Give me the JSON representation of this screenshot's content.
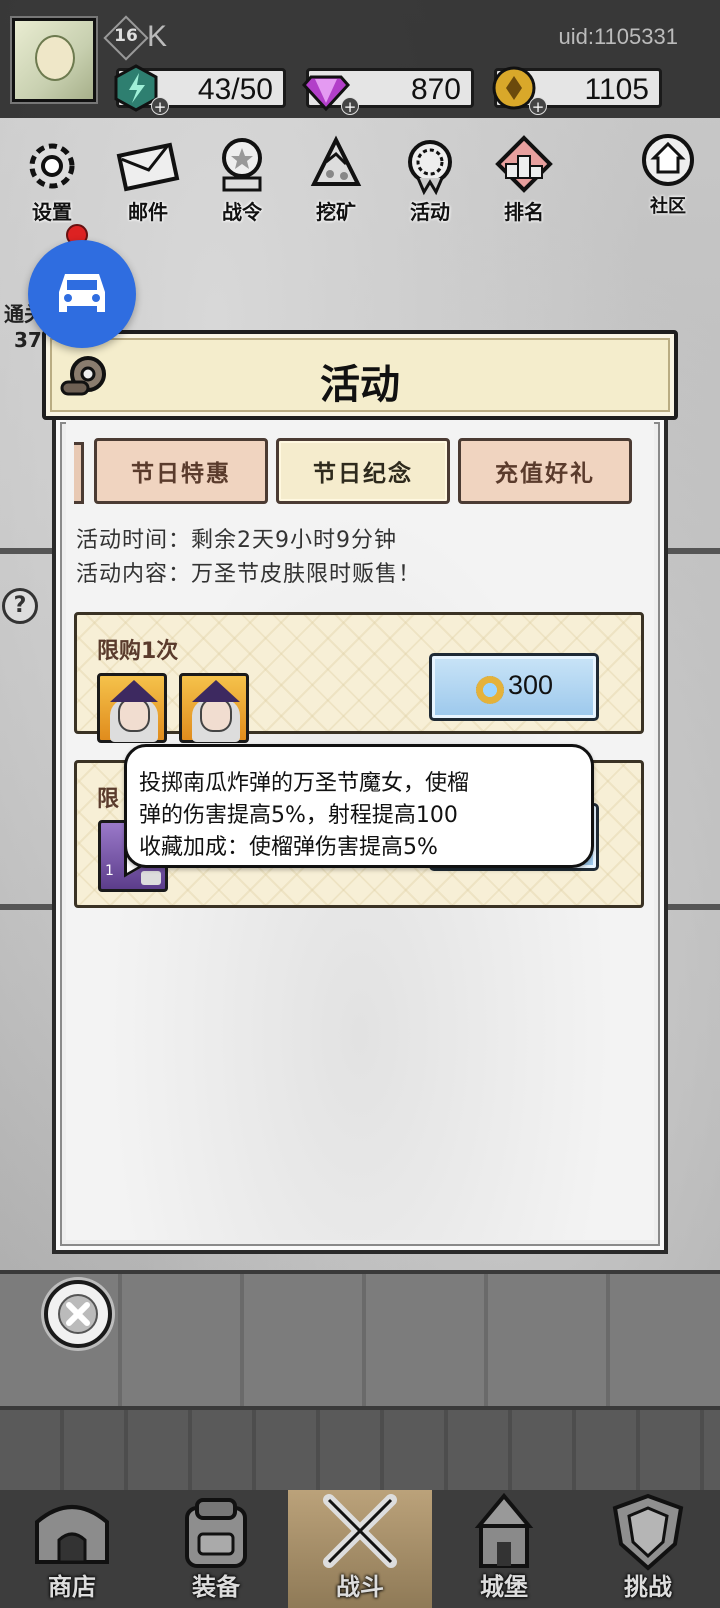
{
  "player": {
    "level": "16",
    "name": "K",
    "uid": "uid:1105331"
  },
  "resources": {
    "energy": "43/50",
    "gems": "870",
    "coins": "1105"
  },
  "top_menu": [
    {
      "label": "设置",
      "icon": "gear-icon"
    },
    {
      "label": "邮件",
      "icon": "mail-icon"
    },
    {
      "label": "战令",
      "icon": "battle-pass-icon"
    },
    {
      "label": "挖矿",
      "icon": "mining-icon"
    },
    {
      "label": "活动",
      "icon": "event-icon"
    },
    {
      "label": "排名",
      "icon": "ranking-icon"
    },
    {
      "label": "社区",
      "icon": "community-home-icon"
    }
  ],
  "side": {
    "text1": "通关",
    "text2": "37"
  },
  "dialog": {
    "title": "活动",
    "tabs": [
      {
        "label": "节日特惠",
        "active": false
      },
      {
        "label": "节日纪念",
        "active": true
      },
      {
        "label": "充值好礼",
        "active": false
      }
    ],
    "time_line": "活动时间：剩余2天9小时9分钟",
    "content_line": "活动内容：万圣节皮肤限时贩售！",
    "offers": [
      {
        "limit": "限购1次",
        "price": "300"
      },
      {
        "limit": "限",
        "price": "",
        "item_count": "1"
      }
    ],
    "tooltip": {
      "line1": "投掷南瓜炸弹的万圣节魔女，使榴",
      "line2": "弹的伤害提高5%，射程提高100",
      "line3": "收藏加成：使榴弹伤害提高5%"
    }
  },
  "bottom_nav": [
    {
      "label": "商店",
      "icon": "shop-icon",
      "active": false
    },
    {
      "label": "装备",
      "icon": "backpack-icon",
      "active": false
    },
    {
      "label": "战斗",
      "icon": "crossed-swords-icon",
      "active": true
    },
    {
      "label": "城堡",
      "icon": "castle-icon",
      "active": false
    },
    {
      "label": "挑战",
      "icon": "shield-icon",
      "active": false
    }
  ],
  "colors": {
    "fab_blue": "#2f6de0",
    "tab_active": "#f5eccd",
    "tab_inactive": "#f0d4c0",
    "buy_button": "#9cc8ec"
  }
}
